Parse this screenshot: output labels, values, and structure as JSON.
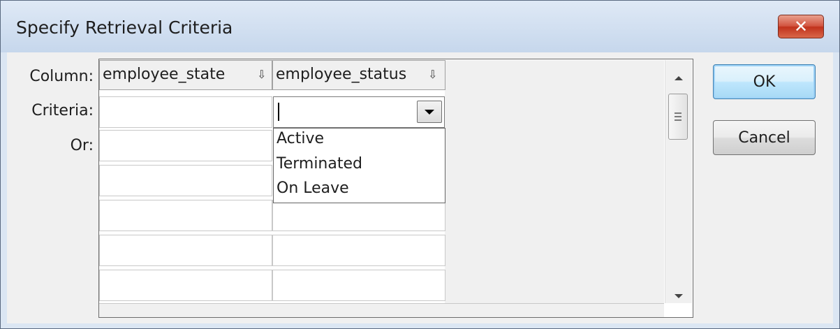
{
  "window": {
    "title": "Specify Retrieval Criteria",
    "close_symbol": "✕"
  },
  "labels": {
    "column": "Column:",
    "criteria": "Criteria:",
    "or": "Or:"
  },
  "grid": {
    "columns": [
      {
        "name": "employee_state",
        "sort_icon": "⇩"
      },
      {
        "name": "employee_status",
        "sort_icon": "⇩"
      }
    ],
    "criteria_rows": 7
  },
  "combo": {
    "value": "",
    "options": [
      "Active",
      "Terminated",
      "On Leave"
    ]
  },
  "buttons": {
    "ok": "OK",
    "cancel": "Cancel"
  },
  "icons": {
    "close": "close-icon",
    "sort": "sort-down-icon",
    "dropdown": "chevron-down-icon"
  }
}
